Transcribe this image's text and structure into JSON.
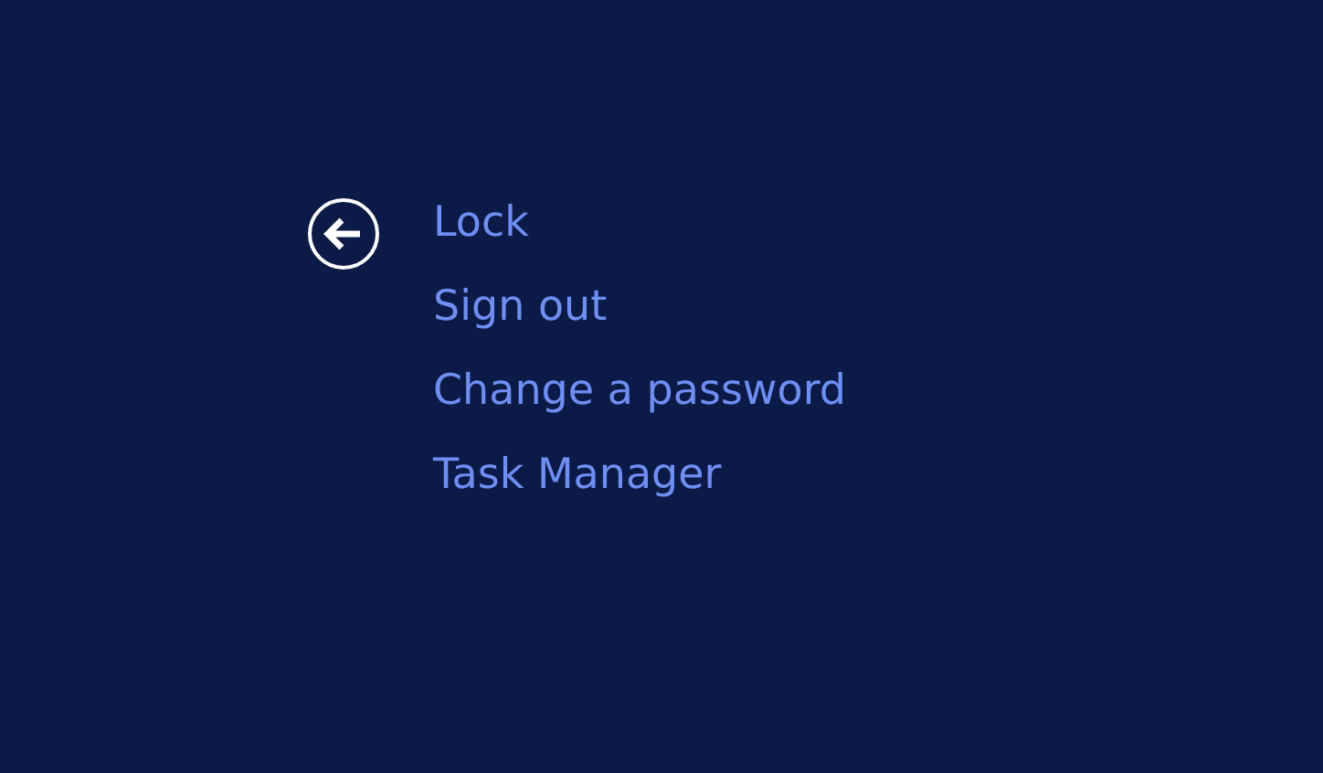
{
  "options": [
    {
      "label": "Lock"
    },
    {
      "label": "Sign out"
    },
    {
      "label": "Change a password"
    },
    {
      "label": "Task Manager"
    }
  ]
}
